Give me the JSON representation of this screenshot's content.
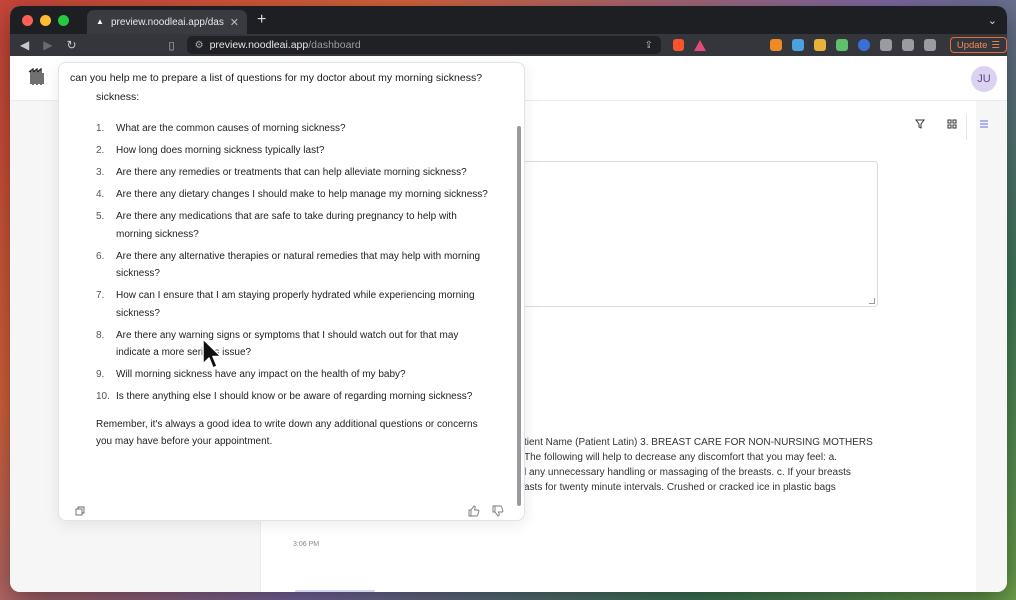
{
  "browser": {
    "tab_title": "preview.noodleai.app/dashboa",
    "url_host": "preview.noodleai.app",
    "url_path": "/dashboard",
    "update_label": "Update"
  },
  "app": {
    "avatar_initials": "JU"
  },
  "chat": {
    "question": "can you help me to prepare a list of questions for my doctor about my morning sickness?",
    "top_cut_text": "sickness:",
    "items": [
      {
        "num": "1.",
        "text": "What are the common causes of morning sickness?"
      },
      {
        "num": "2.",
        "text": "How long does morning sickness typically last?"
      },
      {
        "num": "3.",
        "text": "Are there any remedies or treatments that can help alleviate morning sickness?"
      },
      {
        "num": "4.",
        "text": "Are there any dietary changes I should make to help manage my morning sickness?"
      },
      {
        "num": "5.",
        "text": "Are there any medications that are safe to take during pregnancy to help with morning sickness?"
      },
      {
        "num": "6.",
        "text": "Are there any alternative therapies or natural remedies that may help with morning sickness?"
      },
      {
        "num": "7.",
        "text": "How can I ensure that I am staying properly hydrated while experiencing morning sickness?"
      },
      {
        "num": "8.",
        "text": "Are there any warning signs or symptoms that I should watch out for that may indicate a more serious issue?"
      },
      {
        "num": "9.",
        "text": "Will morning sickness have any impact on the health of my baby?"
      },
      {
        "num": "10.",
        "text": "Is there anything else I should know or be aware of regarding morning sickness?"
      }
    ],
    "closing": "Remember, it's always a good idea to write down any additional questions or concerns you may have before your appointment."
  },
  "background": {
    "lines": [
      "tient Name (Patient Latin) 3. BREAST CARE FOR NON-NURSING MOTHERS",
      "The following will help to decrease any discomfort that you may feel: a.",
      "l any unnecessary handling or massaging of the breasts. c. If your breasts",
      "asts for twenty minute intervals. Crushed or cracked ice in plastic bags"
    ],
    "timestamp": "3:06 PM"
  }
}
